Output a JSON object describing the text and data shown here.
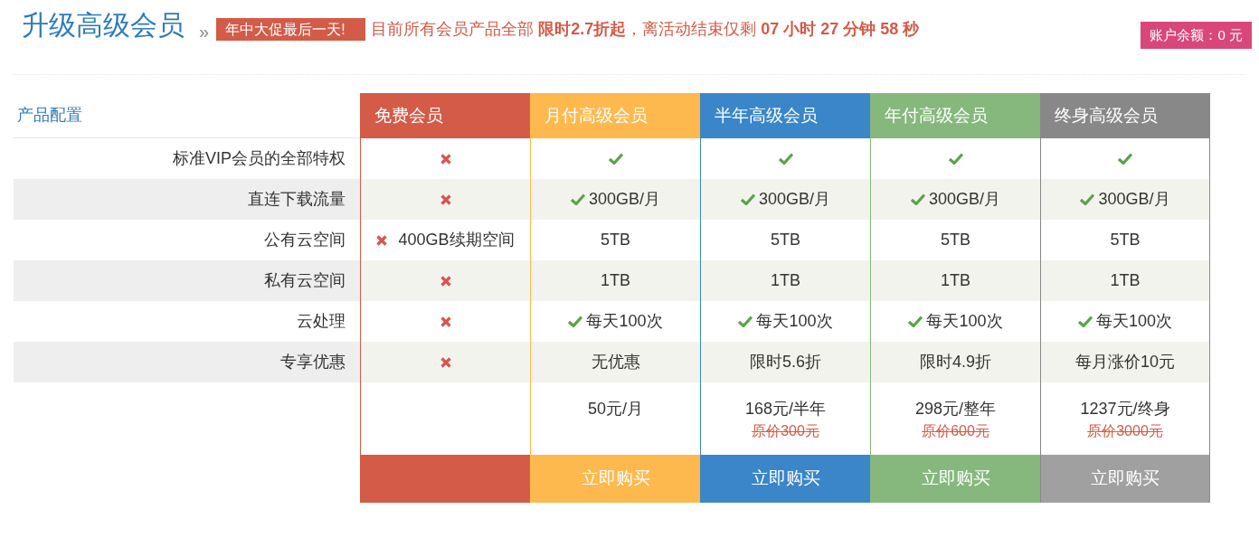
{
  "header": {
    "title": "升级高级会员",
    "separator": "»",
    "promo_badge": "年中大促最后一天!",
    "promo_text": "目前所有会员产品全部 **限时2.7折起**，离活动结束仅剩 **07 小时 27 分钟 58 秒**",
    "balance": "账户余额：0 元"
  },
  "table": {
    "corner": "产品配置",
    "features": [
      "标准VIP会员的全部特权",
      "直连下载流量",
      "公有云空间",
      "私有云空间",
      "云处理",
      "专享优惠"
    ],
    "plans": [
      {
        "name": "免费会员",
        "color": "#d35b47",
        "buy": {
          "color": "#d35b47"
        },
        "cells": [
          {
            "kind": "cross"
          },
          {
            "kind": "cross"
          },
          {
            "kind": "cross",
            "text": "400GB续期空间"
          },
          {
            "kind": "cross"
          },
          {
            "kind": "cross"
          },
          {
            "kind": "cross"
          }
        ]
      },
      {
        "name": "月付高级会员",
        "color": "#fdb94e",
        "price": "50元/月",
        "buy": {
          "label": "立即购买",
          "color": "#fdb94e"
        },
        "cells": [
          {
            "kind": "check"
          },
          {
            "kind": "check",
            "text": "300GB/月"
          },
          {
            "kind": "text",
            "text": "5TB"
          },
          {
            "kind": "text",
            "text": "1TB"
          },
          {
            "kind": "check",
            "text": "每天100次"
          },
          {
            "kind": "text",
            "text": "无优惠"
          }
        ]
      },
      {
        "name": "半年高级会员",
        "color": "#3a86c8",
        "price": "168元/半年",
        "original_price": "原价300元",
        "buy": {
          "label": "立即购买",
          "color": "#3a86c8"
        },
        "cells": [
          {
            "kind": "check"
          },
          {
            "kind": "check",
            "text": "300GB/月"
          },
          {
            "kind": "text",
            "text": "5TB"
          },
          {
            "kind": "text",
            "text": "1TB"
          },
          {
            "kind": "check",
            "text": "每天100次"
          },
          {
            "kind": "text",
            "text": "限时5.6折"
          }
        ]
      },
      {
        "name": "年付高级会员",
        "color": "#86b87d",
        "price": "298元/整年",
        "original_price": "原价600元",
        "buy": {
          "label": "立即购买",
          "color": "#86b87d"
        },
        "cells": [
          {
            "kind": "check"
          },
          {
            "kind": "check",
            "text": "300GB/月"
          },
          {
            "kind": "text",
            "text": "5TB"
          },
          {
            "kind": "text",
            "text": "1TB"
          },
          {
            "kind": "check",
            "text": "每天100次"
          },
          {
            "kind": "text",
            "text": "限时4.9折"
          }
        ]
      },
      {
        "name": "终身高级会员",
        "color": "#888888",
        "price": "1237元/终身",
        "original_price": "原价3000元",
        "buy": {
          "label": "立即购买",
          "color": "#a0a0a0"
        },
        "cells": [
          {
            "kind": "check"
          },
          {
            "kind": "check",
            "text": "300GB/月"
          },
          {
            "kind": "text",
            "text": "5TB"
          },
          {
            "kind": "text",
            "text": "1TB"
          },
          {
            "kind": "check",
            "text": "每天100次"
          },
          {
            "kind": "text",
            "text": "每月涨价10元"
          }
        ]
      }
    ]
  }
}
